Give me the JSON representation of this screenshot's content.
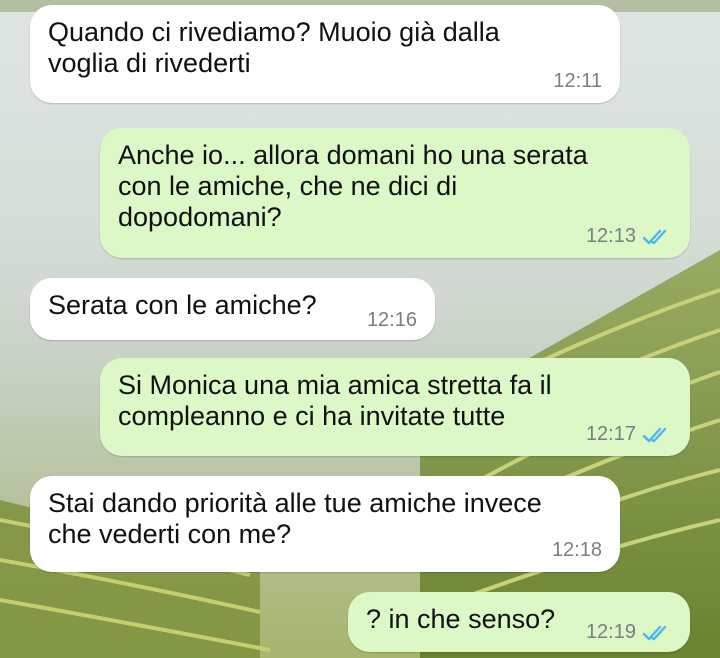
{
  "messages": [
    {
      "direction": "incoming",
      "text": "Quando ci rivediamo? Muoio già dalla\nvoglia di rivederti",
      "time": "12:11"
    },
    {
      "direction": "outgoing",
      "text": "Anche io... allora domani ho una serata\ncon le amiche, che ne dici di\ndopodomani?",
      "time": "12:13",
      "status_icon": "double-check-read-icon"
    },
    {
      "direction": "incoming",
      "text": "Serata con le amiche?",
      "time": "12:16"
    },
    {
      "direction": "outgoing",
      "text": "Si Monica una mia amica stretta fa il\ncompleanno e ci ha invitate tutte",
      "time": "12:17",
      "status_icon": "double-check-read-icon"
    },
    {
      "direction": "incoming",
      "text": "Stai dando priorità alle tue amiche invece\nche vederti con me?",
      "time": "12:18"
    },
    {
      "direction": "outgoing",
      "text": "? in che senso?",
      "time": "12:19",
      "status_icon": "double-check-read-icon"
    }
  ],
  "colors": {
    "incoming_bubble": "#ffffff",
    "outgoing_bubble": "#dcf8c6",
    "read_ticks": "#4fb6ec",
    "time_text": "#7a7f83"
  }
}
